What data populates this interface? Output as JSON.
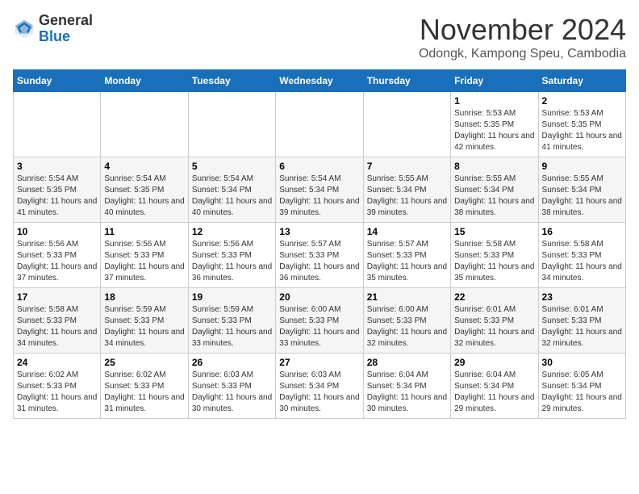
{
  "header": {
    "logo": {
      "general": "General",
      "blue": "Blue"
    },
    "month": "November 2024",
    "location": "Odongk, Kampong Speu, Cambodia"
  },
  "weekdays": [
    "Sunday",
    "Monday",
    "Tuesday",
    "Wednesday",
    "Thursday",
    "Friday",
    "Saturday"
  ],
  "weeks": [
    [
      {
        "day": "",
        "sunrise": "",
        "sunset": "",
        "daylight": ""
      },
      {
        "day": "",
        "sunrise": "",
        "sunset": "",
        "daylight": ""
      },
      {
        "day": "",
        "sunrise": "",
        "sunset": "",
        "daylight": ""
      },
      {
        "day": "",
        "sunrise": "",
        "sunset": "",
        "daylight": ""
      },
      {
        "day": "",
        "sunrise": "",
        "sunset": "",
        "daylight": ""
      },
      {
        "day": "1",
        "sunrise": "Sunrise: 5:53 AM",
        "sunset": "Sunset: 5:35 PM",
        "daylight": "Daylight: 11 hours and 42 minutes."
      },
      {
        "day": "2",
        "sunrise": "Sunrise: 5:53 AM",
        "sunset": "Sunset: 5:35 PM",
        "daylight": "Daylight: 11 hours and 41 minutes."
      }
    ],
    [
      {
        "day": "3",
        "sunrise": "Sunrise: 5:54 AM",
        "sunset": "Sunset: 5:35 PM",
        "daylight": "Daylight: 11 hours and 41 minutes."
      },
      {
        "day": "4",
        "sunrise": "Sunrise: 5:54 AM",
        "sunset": "Sunset: 5:35 PM",
        "daylight": "Daylight: 11 hours and 40 minutes."
      },
      {
        "day": "5",
        "sunrise": "Sunrise: 5:54 AM",
        "sunset": "Sunset: 5:34 PM",
        "daylight": "Daylight: 11 hours and 40 minutes."
      },
      {
        "day": "6",
        "sunrise": "Sunrise: 5:54 AM",
        "sunset": "Sunset: 5:34 PM",
        "daylight": "Daylight: 11 hours and 39 minutes."
      },
      {
        "day": "7",
        "sunrise": "Sunrise: 5:55 AM",
        "sunset": "Sunset: 5:34 PM",
        "daylight": "Daylight: 11 hours and 39 minutes."
      },
      {
        "day": "8",
        "sunrise": "Sunrise: 5:55 AM",
        "sunset": "Sunset: 5:34 PM",
        "daylight": "Daylight: 11 hours and 38 minutes."
      },
      {
        "day": "9",
        "sunrise": "Sunrise: 5:55 AM",
        "sunset": "Sunset: 5:34 PM",
        "daylight": "Daylight: 11 hours and 38 minutes."
      }
    ],
    [
      {
        "day": "10",
        "sunrise": "Sunrise: 5:56 AM",
        "sunset": "Sunset: 5:33 PM",
        "daylight": "Daylight: 11 hours and 37 minutes."
      },
      {
        "day": "11",
        "sunrise": "Sunrise: 5:56 AM",
        "sunset": "Sunset: 5:33 PM",
        "daylight": "Daylight: 11 hours and 37 minutes."
      },
      {
        "day": "12",
        "sunrise": "Sunrise: 5:56 AM",
        "sunset": "Sunset: 5:33 PM",
        "daylight": "Daylight: 11 hours and 36 minutes."
      },
      {
        "day": "13",
        "sunrise": "Sunrise: 5:57 AM",
        "sunset": "Sunset: 5:33 PM",
        "daylight": "Daylight: 11 hours and 36 minutes."
      },
      {
        "day": "14",
        "sunrise": "Sunrise: 5:57 AM",
        "sunset": "Sunset: 5:33 PM",
        "daylight": "Daylight: 11 hours and 35 minutes."
      },
      {
        "day": "15",
        "sunrise": "Sunrise: 5:58 AM",
        "sunset": "Sunset: 5:33 PM",
        "daylight": "Daylight: 11 hours and 35 minutes."
      },
      {
        "day": "16",
        "sunrise": "Sunrise: 5:58 AM",
        "sunset": "Sunset: 5:33 PM",
        "daylight": "Daylight: 11 hours and 34 minutes."
      }
    ],
    [
      {
        "day": "17",
        "sunrise": "Sunrise: 5:58 AM",
        "sunset": "Sunset: 5:33 PM",
        "daylight": "Daylight: 11 hours and 34 minutes."
      },
      {
        "day": "18",
        "sunrise": "Sunrise: 5:59 AM",
        "sunset": "Sunset: 5:33 PM",
        "daylight": "Daylight: 11 hours and 34 minutes."
      },
      {
        "day": "19",
        "sunrise": "Sunrise: 5:59 AM",
        "sunset": "Sunset: 5:33 PM",
        "daylight": "Daylight: 11 hours and 33 minutes."
      },
      {
        "day": "20",
        "sunrise": "Sunrise: 6:00 AM",
        "sunset": "Sunset: 5:33 PM",
        "daylight": "Daylight: 11 hours and 33 minutes."
      },
      {
        "day": "21",
        "sunrise": "Sunrise: 6:00 AM",
        "sunset": "Sunset: 5:33 PM",
        "daylight": "Daylight: 11 hours and 32 minutes."
      },
      {
        "day": "22",
        "sunrise": "Sunrise: 6:01 AM",
        "sunset": "Sunset: 5:33 PM",
        "daylight": "Daylight: 11 hours and 32 minutes."
      },
      {
        "day": "23",
        "sunrise": "Sunrise: 6:01 AM",
        "sunset": "Sunset: 5:33 PM",
        "daylight": "Daylight: 11 hours and 32 minutes."
      }
    ],
    [
      {
        "day": "24",
        "sunrise": "Sunrise: 6:02 AM",
        "sunset": "Sunset: 5:33 PM",
        "daylight": "Daylight: 11 hours and 31 minutes."
      },
      {
        "day": "25",
        "sunrise": "Sunrise: 6:02 AM",
        "sunset": "Sunset: 5:33 PM",
        "daylight": "Daylight: 11 hours and 31 minutes."
      },
      {
        "day": "26",
        "sunrise": "Sunrise: 6:03 AM",
        "sunset": "Sunset: 5:33 PM",
        "daylight": "Daylight: 11 hours and 30 minutes."
      },
      {
        "day": "27",
        "sunrise": "Sunrise: 6:03 AM",
        "sunset": "Sunset: 5:34 PM",
        "daylight": "Daylight: 11 hours and 30 minutes."
      },
      {
        "day": "28",
        "sunrise": "Sunrise: 6:04 AM",
        "sunset": "Sunset: 5:34 PM",
        "daylight": "Daylight: 11 hours and 30 minutes."
      },
      {
        "day": "29",
        "sunrise": "Sunrise: 6:04 AM",
        "sunset": "Sunset: 5:34 PM",
        "daylight": "Daylight: 11 hours and 29 minutes."
      },
      {
        "day": "30",
        "sunrise": "Sunrise: 6:05 AM",
        "sunset": "Sunset: 5:34 PM",
        "daylight": "Daylight: 11 hours and 29 minutes."
      }
    ]
  ]
}
